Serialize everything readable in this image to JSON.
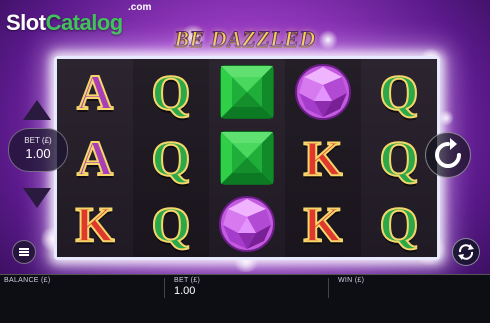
{
  "site": {
    "name_part1": "Slot",
    "name_part2": "Catalog",
    "domain_suffix": ".com"
  },
  "game": {
    "title": "BE DAZZLED"
  },
  "reels": [
    [
      "A",
      "A",
      "K"
    ],
    [
      "Q",
      "Q",
      "Q"
    ],
    [
      "green-gem",
      "green-gem",
      "purple-gem"
    ],
    [
      "purple-gem",
      "K",
      "K"
    ],
    [
      "Q",
      "Q",
      "Q"
    ]
  ],
  "controls": {
    "bet_label": "BET (£)",
    "bet_value": "1.00",
    "bet_up_icon": "triangle-up-icon",
    "bet_down_icon": "triangle-down-icon",
    "menu_icon": "hamburger-icon",
    "spin_icon": "refresh-arrow-icon",
    "autoplay_icon": "autoplay-arrows-icon"
  },
  "bottom_bar": {
    "balance_label": "BALANCE (£)",
    "balance_value": "",
    "bet_label": "BET (£)",
    "bet_value": "1.00",
    "win_label": "WIN (£)",
    "win_value": ""
  },
  "colors": {
    "letter_A": "#a83fb8",
    "letter_Q": "#2aa84a",
    "letter_K": "#e0382c",
    "gem_green": "#22b83a",
    "gem_purple": "#c45ae0",
    "title_gold": "#f7d23a",
    "logo_green": "#3fc35a"
  }
}
